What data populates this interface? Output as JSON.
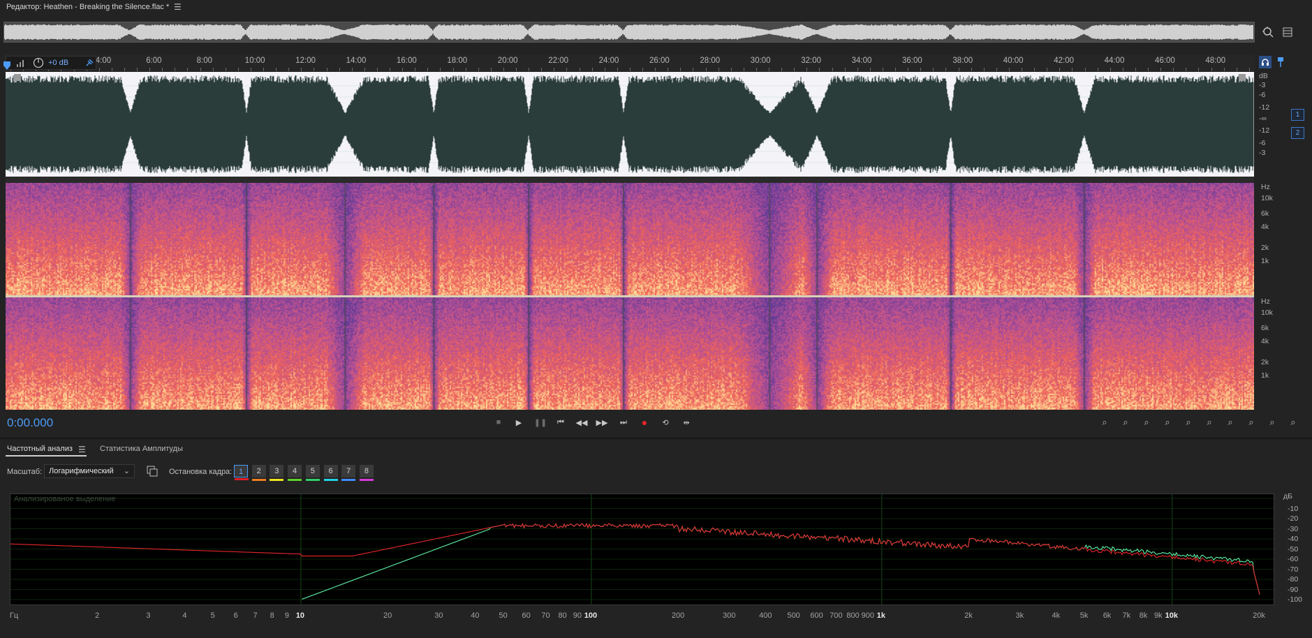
{
  "window": {
    "title": "Редактор: Heathen - Breaking the Silence.flac *",
    "menu_icon": "hamburger-menu-icon"
  },
  "overview": {
    "zoom_icon": "zoom-navigator-icon",
    "layout_icon": "panel-layout-icon"
  },
  "ruler": {
    "labels": [
      "4:00",
      "6:00",
      "8:00",
      "10:00",
      "12:00",
      "14:00",
      "16:00",
      "18:00",
      "20:00",
      "22:00",
      "24:00",
      "26:00",
      "28:00",
      "30:00",
      "32:00",
      "34:00",
      "36:00",
      "38:00",
      "40:00",
      "42:00",
      "44:00",
      "46:00",
      "48:00"
    ],
    "hud_volume": "+0 dB"
  },
  "waveform": {
    "db_labels": [
      "dB",
      "-3",
      "-6",
      "-12",
      "-∞",
      "-12",
      "-6",
      "-3"
    ],
    "channels": [
      "1",
      "2"
    ]
  },
  "spectrogram": {
    "hz_labels": [
      "Hz",
      "10k",
      "6k",
      "4k",
      "2k",
      "1k"
    ]
  },
  "transport": {
    "timecode": "0:00.000",
    "buttons": [
      "stop-icon",
      "play-icon",
      "pause-icon",
      "skip-start-icon",
      "rewind-icon",
      "fast-forward-icon",
      "skip-end-icon",
      "record-icon",
      "loop-icon",
      "skip-selection-icon"
    ]
  },
  "panel": {
    "tabs": [
      "Частотный анализ",
      "Статистика Амплитуды"
    ],
    "scale_label": "Масштаб:",
    "scale_value": "Логарифмический",
    "freeze_label": "Остановка кадра:",
    "freeze_slots": [
      "1",
      "2",
      "3",
      "4",
      "5",
      "6",
      "7",
      "8"
    ],
    "freeze_colors": [
      "#e0202a",
      "#f07d1c",
      "#f0e41e",
      "#5fd22b",
      "#2fd06a",
      "#22d2e6",
      "#3f8cff",
      "#d63ad6"
    ],
    "plot_caption": "Анализированое выделение",
    "db_labels": [
      "дБ",
      "-10",
      "-20",
      "-30",
      "-40",
      "-50",
      "-60",
      "-70",
      "-80",
      "-90",
      "-100"
    ],
    "hz_labels": [
      "Гц",
      "2",
      "3",
      "4",
      "5",
      "6",
      "7",
      "8",
      "9",
      "10",
      "20",
      "30",
      "40",
      "50",
      "60",
      "70",
      "80",
      "90",
      "100",
      "200",
      "300",
      "400",
      "500",
      "600",
      "700",
      "800",
      "900",
      "1k",
      "2k",
      "3k",
      "4k",
      "5k",
      "6k",
      "7k",
      "8k",
      "9k",
      "10k",
      "20k"
    ]
  },
  "colors": {
    "accent": "#4d9cf8",
    "waveform_fill": "#2b3d3a",
    "curve_red": "#e8262a",
    "curve_green": "#5ff2a8"
  }
}
